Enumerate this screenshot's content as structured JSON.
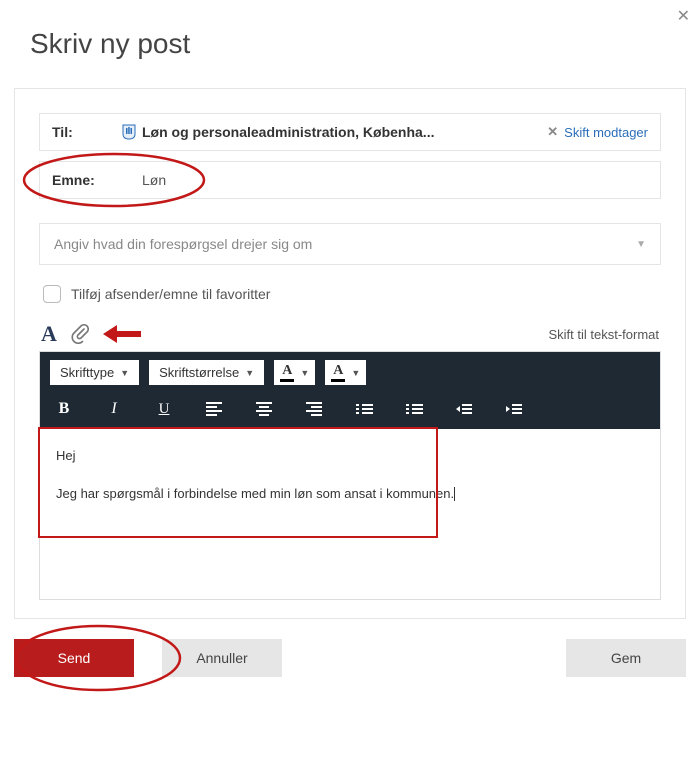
{
  "page": {
    "title": "Skriv ny post"
  },
  "recipient": {
    "label": "Til:",
    "value": "Løn og personaleadministration, Københa...",
    "change_link": "Skift modtager"
  },
  "subject": {
    "label": "Emne:",
    "value": "Løn"
  },
  "topic": {
    "placeholder": "Angiv hvad din forespørgsel drejer sig om"
  },
  "favorite": {
    "label": "Tilføj afsender/emne til favoritter"
  },
  "editor": {
    "switch_format": "Skift til tekst-format",
    "font_family_label": "Skrifttype",
    "font_size_label": "Skriftstørrelse",
    "body_line1": "Hej",
    "body_line2": "Jeg har spørgsmål i forbindelse med min løn som ansat i kommunen."
  },
  "buttons": {
    "send": "Send",
    "cancel": "Annuller",
    "save": "Gem"
  }
}
